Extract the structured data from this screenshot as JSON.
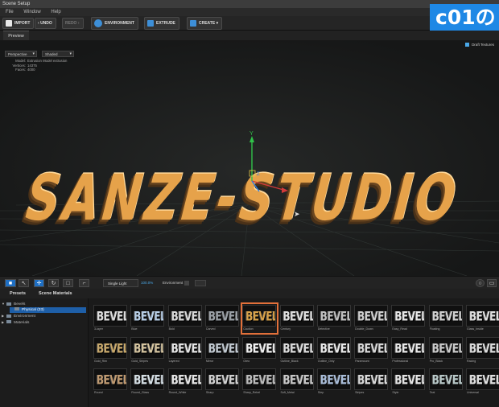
{
  "window": {
    "title": "Scene Setup"
  },
  "menu": [
    "File",
    "Window",
    "Help"
  ],
  "toolbar": {
    "import": "IMPORT",
    "undo": "UNDO",
    "redo": "REDO",
    "environment": "ENVIRONMENT",
    "extrude": "EXTRUDE",
    "create": "CREATE"
  },
  "overlay_badge": "c01の",
  "tabs": {
    "preview": "Preview"
  },
  "viewport": {
    "view_mode": "Perspective",
    "shade_mode": "Shaded",
    "draft_textures": "Draft Textures",
    "info": [
      {
        "k": "Model:",
        "v": "Extrusion Model extrusion"
      },
      {
        "k": "Vertices:",
        "v": "14375"
      },
      {
        "k": "Faces:",
        "v": "4000"
      }
    ],
    "logo_text": "SANZE-STUDIO",
    "axis_y_label": "Y",
    "axis_z_label": "Z",
    "accent": "#e6a24a"
  },
  "bottom_bar": {
    "light_mode": "Single Light",
    "light_percent": "100.0%",
    "environment_label": "Environment"
  },
  "lower_tabs": {
    "presets": "Presets",
    "scene_materials": "Scene Materials"
  },
  "tree": [
    {
      "label": "Bevels",
      "arrow": "▼",
      "indent": 0,
      "selected": false
    },
    {
      "label": "Physical (33)",
      "arrow": "",
      "indent": 1,
      "selected": true
    },
    {
      "label": "Environment",
      "arrow": "▶",
      "indent": 0,
      "selected": false
    },
    {
      "label": "Materials",
      "arrow": "▶",
      "indent": 0,
      "selected": false
    }
  ],
  "thumb_text": "BEVEL",
  "presets": [
    {
      "label": "3-layer",
      "color": "#dddddd"
    },
    {
      "label": "Blue",
      "color": "#b9d0e8"
    },
    {
      "label": "Bold",
      "color": "#d8d8d8"
    },
    {
      "label": "Carved",
      "color": "#9aa0a6"
    },
    {
      "label": "Caution",
      "color": "#d8a24a",
      "selected": true
    },
    {
      "label": "Century",
      "color": "#e0e0e0"
    },
    {
      "label": "Detective",
      "color": "#bfbfbf"
    },
    {
      "label": "Double_Down",
      "color": "#cfcfcf"
    },
    {
      "label": "Easy_Read",
      "color": "#e8e8e8"
    },
    {
      "label": "Floating",
      "color": "#d0d0d0"
    },
    {
      "label": "Glass_Inside",
      "color": "#e0e0e0"
    },
    {
      "label": "Gold_Rim",
      "color": "#c8a86a"
    },
    {
      "label": "Gold_Stripes",
      "color": "#d6c5a0"
    },
    {
      "label": "Layered",
      "color": "#e4e4e4"
    },
    {
      "label": "Mirror",
      "color": "#c0c8d0"
    },
    {
      "label": "Oreo",
      "color": "#f0f0f0"
    },
    {
      "label": "Outline_Black",
      "color": "#dcdcdc"
    },
    {
      "label": "Outline_Only",
      "color": "#e8e8e8"
    },
    {
      "label": "Paramount",
      "color": "#d8d8d8"
    },
    {
      "label": "Professional",
      "color": "#e8e8e8"
    },
    {
      "label": "Pro_Black",
      "color": "#c8c8c8"
    },
    {
      "label": "Racing",
      "color": "#dcdcdc"
    },
    {
      "label": "Round",
      "color": "#c09a70"
    },
    {
      "label": "Round_Glass",
      "color": "#d6e0e6"
    },
    {
      "label": "Round_White",
      "color": "#e6e6e6"
    },
    {
      "label": "Sharp",
      "color": "#d0d0d0"
    },
    {
      "label": "Sharp_Rebel",
      "color": "#bcbcbc"
    },
    {
      "label": "Soft_Metal",
      "color": "#c8c8c8"
    },
    {
      "label": "Step",
      "color": "#a8bcd8"
    },
    {
      "label": "Stripes",
      "color": "#d8d8d8"
    },
    {
      "label": "Style",
      "color": "#e4e4e4"
    },
    {
      "label": "Teal",
      "color": "#b8c8c8"
    },
    {
      "label": "Universal",
      "color": "#e0e0e0"
    }
  ]
}
